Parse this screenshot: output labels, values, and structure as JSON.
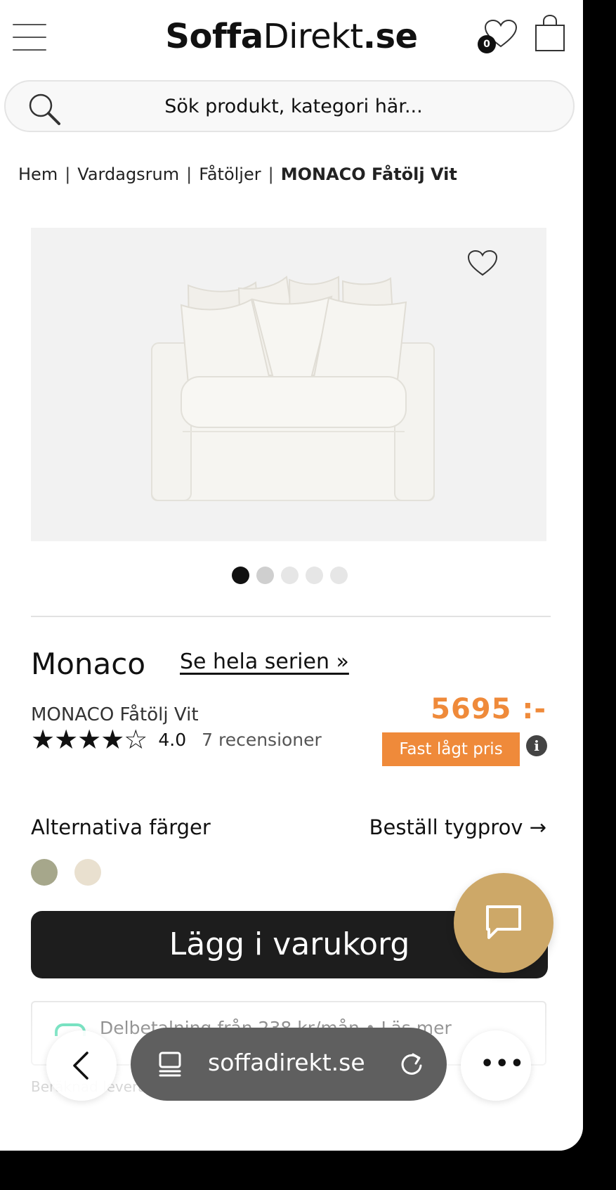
{
  "header": {
    "logo_bold": "Soffa",
    "logo_light": "Direkt",
    "logo_suffix": ".se",
    "wishlist_count": "0"
  },
  "search": {
    "placeholder": "Sök produkt, kategori här..."
  },
  "breadcrumb": {
    "items": [
      "Hem",
      "Vardagsrum",
      "Fåtöljer"
    ],
    "current": "MONACO Fåtölj Vit",
    "separator": "|"
  },
  "gallery": {
    "image_icon": "armchair-image",
    "slide_count": 5,
    "active_slide": 1
  },
  "product": {
    "series_name": "Monaco",
    "series_link": "Se hela serien »",
    "title": "MONACO Fåtölj Vit",
    "stars": "★★★★☆",
    "rating": "4.0",
    "reviews": "7 recensioner",
    "price": "5695 :-",
    "price_badge": "Fast lågt pris",
    "info_icon": "i",
    "price_color": "#ef8a3a"
  },
  "options": {
    "alt_colors_label": "Alternativa färger",
    "fabric_sample_link": "Beställ tygprov →",
    "swatches": [
      "#a6a78b",
      "#e9e0cf"
    ]
  },
  "actions": {
    "add_to_cart": "Lägg i varukorg"
  },
  "installment": {
    "text": "Delbetalning från 238 kr/mån • Läs mer"
  },
  "delivery": {
    "text": "Beräknad leverans"
  },
  "browser": {
    "url": "soffadirekt.se"
  }
}
